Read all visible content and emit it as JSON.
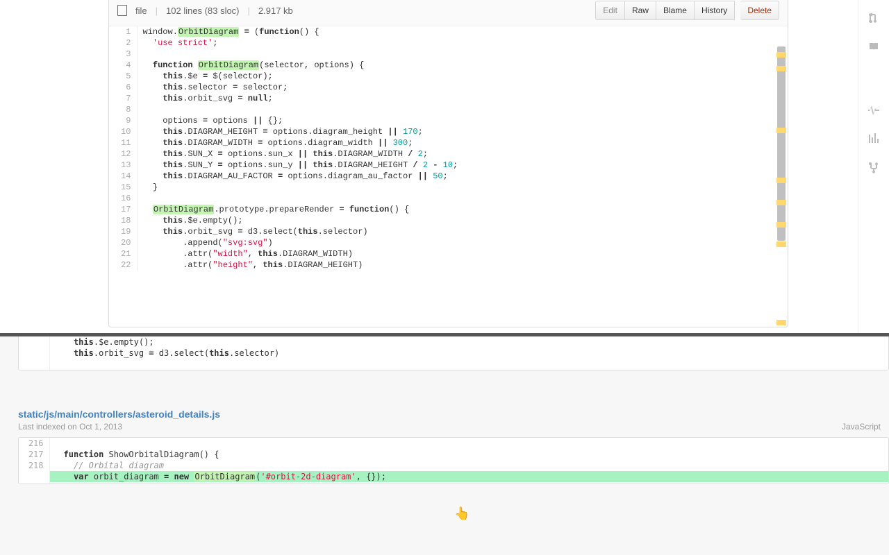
{
  "file_info": {
    "label_file": "file",
    "lines_stat": "102 lines (83 sloc)",
    "size": "2.917 kb"
  },
  "actions": {
    "edit": "Edit",
    "raw": "Raw",
    "blame": "Blame",
    "history": "History",
    "delete": "Delete"
  },
  "highlight_identifier": "OrbitDiagram",
  "scroll_marks_pct": [
    2,
    7,
    29,
    47,
    55,
    63,
    70,
    98
  ],
  "code_top": [
    {
      "n": 1,
      "t": [
        [
          "p",
          "window."
        ],
        [
          "hl",
          "OrbitDiagram"
        ],
        [
          "p",
          " "
        ],
        [
          "kw",
          "="
        ],
        [
          "p",
          " ("
        ],
        [
          "kw",
          "function"
        ],
        [
          "p",
          "() {"
        ]
      ]
    },
    {
      "n": 2,
      "t": [
        [
          "p",
          "  "
        ],
        [
          "str",
          "'use strict'"
        ],
        [
          "p",
          ";"
        ]
      ]
    },
    {
      "n": 3,
      "t": []
    },
    {
      "n": 4,
      "t": [
        [
          "p",
          "  "
        ],
        [
          "kw",
          "function"
        ],
        [
          "p",
          " "
        ],
        [
          "hl",
          "OrbitDiagram"
        ],
        [
          "p",
          "(selector, options) {"
        ]
      ]
    },
    {
      "n": 5,
      "t": [
        [
          "p",
          "    "
        ],
        [
          "kw",
          "this"
        ],
        [
          "p",
          ".$e "
        ],
        [
          "kw",
          "="
        ],
        [
          "p",
          " $(selector);"
        ]
      ]
    },
    {
      "n": 6,
      "t": [
        [
          "p",
          "    "
        ],
        [
          "kw",
          "this"
        ],
        [
          "p",
          ".selector "
        ],
        [
          "kw",
          "="
        ],
        [
          "p",
          " selector;"
        ]
      ]
    },
    {
      "n": 7,
      "t": [
        [
          "p",
          "    "
        ],
        [
          "kw",
          "this"
        ],
        [
          "p",
          ".orbit_svg "
        ],
        [
          "kw",
          "="
        ],
        [
          "p",
          " "
        ],
        [
          "kw",
          "null"
        ],
        [
          "p",
          ";"
        ]
      ]
    },
    {
      "n": 8,
      "t": []
    },
    {
      "n": 9,
      "t": [
        [
          "p",
          "    options "
        ],
        [
          "kw",
          "="
        ],
        [
          "p",
          " options "
        ],
        [
          "kw",
          "||"
        ],
        [
          "p",
          " {};"
        ]
      ]
    },
    {
      "n": 10,
      "t": [
        [
          "p",
          "    "
        ],
        [
          "kw",
          "this"
        ],
        [
          "p",
          ".DIAGRAM_HEIGHT "
        ],
        [
          "kw",
          "="
        ],
        [
          "p",
          " options.diagram_height "
        ],
        [
          "kw",
          "||"
        ],
        [
          "p",
          " "
        ],
        [
          "num",
          "170"
        ],
        [
          "p",
          ";"
        ]
      ]
    },
    {
      "n": 11,
      "t": [
        [
          "p",
          "    "
        ],
        [
          "kw",
          "this"
        ],
        [
          "p",
          ".DIAGRAM_WIDTH "
        ],
        [
          "kw",
          "="
        ],
        [
          "p",
          " options.diagram_width "
        ],
        [
          "kw",
          "||"
        ],
        [
          "p",
          " "
        ],
        [
          "num",
          "300"
        ],
        [
          "p",
          ";"
        ]
      ]
    },
    {
      "n": 12,
      "t": [
        [
          "p",
          "    "
        ],
        [
          "kw",
          "this"
        ],
        [
          "p",
          ".SUN_X "
        ],
        [
          "kw",
          "="
        ],
        [
          "p",
          " options.sun_x "
        ],
        [
          "kw",
          "||"
        ],
        [
          "p",
          " "
        ],
        [
          "kw",
          "this"
        ],
        [
          "p",
          ".DIAGRAM_WIDTH "
        ],
        [
          "kw",
          "/"
        ],
        [
          "p",
          " "
        ],
        [
          "num",
          "2"
        ],
        [
          "p",
          ";"
        ]
      ]
    },
    {
      "n": 13,
      "t": [
        [
          "p",
          "    "
        ],
        [
          "kw",
          "this"
        ],
        [
          "p",
          ".SUN_Y "
        ],
        [
          "kw",
          "="
        ],
        [
          "p",
          " options.sun_y "
        ],
        [
          "kw",
          "||"
        ],
        [
          "p",
          " "
        ],
        [
          "kw",
          "this"
        ],
        [
          "p",
          ".DIAGRAM_HEIGHT "
        ],
        [
          "kw",
          "/"
        ],
        [
          "p",
          " "
        ],
        [
          "num",
          "2"
        ],
        [
          "p",
          " "
        ],
        [
          "kw",
          "-"
        ],
        [
          "p",
          " "
        ],
        [
          "num",
          "10"
        ],
        [
          "p",
          ";"
        ]
      ]
    },
    {
      "n": 14,
      "t": [
        [
          "p",
          "    "
        ],
        [
          "kw",
          "this"
        ],
        [
          "p",
          ".DIAGRAM_AU_FACTOR "
        ],
        [
          "kw",
          "="
        ],
        [
          "p",
          " options.diagram_au_factor "
        ],
        [
          "kw",
          "||"
        ],
        [
          "p",
          " "
        ],
        [
          "num",
          "50"
        ],
        [
          "p",
          ";"
        ]
      ]
    },
    {
      "n": 15,
      "t": [
        [
          "p",
          "  }"
        ]
      ]
    },
    {
      "n": 16,
      "t": []
    },
    {
      "n": 17,
      "t": [
        [
          "p",
          "  "
        ],
        [
          "hl",
          "OrbitDiagram"
        ],
        [
          "p",
          ".prototype.prepareRender "
        ],
        [
          "kw",
          "="
        ],
        [
          "p",
          " "
        ],
        [
          "kw",
          "function"
        ],
        [
          "p",
          "() {"
        ]
      ]
    },
    {
      "n": 18,
      "t": [
        [
          "p",
          "    "
        ],
        [
          "kw",
          "this"
        ],
        [
          "p",
          ".$e.empty();"
        ]
      ]
    },
    {
      "n": 19,
      "t": [
        [
          "p",
          "    "
        ],
        [
          "kw",
          "this"
        ],
        [
          "p",
          ".orbit_svg "
        ],
        [
          "kw",
          "="
        ],
        [
          "p",
          " d3.select("
        ],
        [
          "kw",
          "this"
        ],
        [
          "p",
          ".selector)"
        ]
      ]
    },
    {
      "n": 20,
      "t": [
        [
          "p",
          "        .append("
        ],
        [
          "str",
          "\"svg:svg\""
        ],
        [
          "p",
          ")"
        ]
      ]
    },
    {
      "n": 21,
      "t": [
        [
          "p",
          "        .attr("
        ],
        [
          "str",
          "\"width\""
        ],
        [
          "p",
          ", "
        ],
        [
          "kw",
          "this"
        ],
        [
          "p",
          ".DIAGRAM_WIDTH)"
        ]
      ]
    },
    {
      "n": 22,
      "t": [
        [
          "p",
          "        .attr("
        ],
        [
          "str",
          "\"height\""
        ],
        [
          "p",
          ", "
        ],
        [
          "kw",
          "this"
        ],
        [
          "p",
          ".DIAGRAM_HEIGHT)"
        ]
      ]
    }
  ],
  "snippet_a": [
    {
      "t": [
        [
          "p",
          "  "
        ],
        [
          "kw",
          "this"
        ],
        [
          "p",
          ".$e.empty();"
        ]
      ]
    },
    {
      "t": [
        [
          "p",
          "  "
        ],
        [
          "kw",
          "this"
        ],
        [
          "p",
          ".orbit_svg "
        ],
        [
          "kw",
          "="
        ],
        [
          "p",
          " d3.select("
        ],
        [
          "kw",
          "this"
        ],
        [
          "p",
          ".selector)"
        ]
      ]
    }
  ],
  "result_file": {
    "path": "static/js/main/controllers/asteroid_details.js",
    "indexed": "Last indexed on Oct 1, 2013",
    "lang": "JavaScript"
  },
  "snippet_b": [
    {
      "n": 216,
      "hl": false,
      "t": []
    },
    {
      "n": 217,
      "hl": false,
      "t": [
        [
          "kw",
          "function"
        ],
        [
          "p",
          " ShowOrbitalDiagram() {"
        ]
      ]
    },
    {
      "n": 218,
      "hl": false,
      "t": [
        [
          "p",
          "  "
        ],
        [
          "cm",
          "// Orbital diagram"
        ]
      ]
    },
    {
      "n": "",
      "hl": true,
      "t": [
        [
          "p",
          "  "
        ],
        [
          "kw",
          "var"
        ],
        [
          "p",
          " orbit_diagram "
        ],
        [
          "kw",
          "="
        ],
        [
          "p",
          " "
        ],
        [
          "kw",
          "new"
        ],
        [
          "p",
          " "
        ],
        [
          "hl",
          "OrbitDiagram"
        ],
        [
          "p",
          "("
        ],
        [
          "str",
          "'#orbit-2d-diagram'"
        ],
        [
          "p",
          ", {});"
        ]
      ]
    },
    {
      "n": "",
      "hl": false,
      "t": []
    }
  ]
}
